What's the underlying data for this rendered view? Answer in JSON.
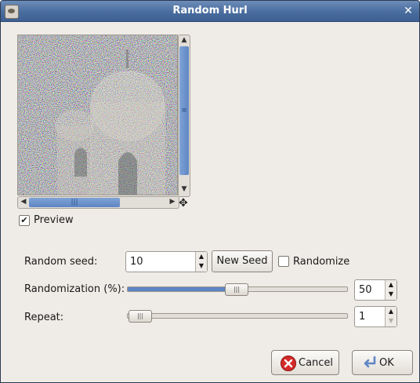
{
  "window": {
    "title": "Random Hurl"
  },
  "preview": {
    "checkbox_checked": true,
    "label": "Preview"
  },
  "random_seed": {
    "label": "Random seed:",
    "value": "10",
    "new_seed_label": "New Seed",
    "randomize_label": "Randomize",
    "randomize_checked": false
  },
  "randomization": {
    "label": "Randomization (%):",
    "value": "50",
    "slider_fraction": 0.5
  },
  "repeat": {
    "label": "Repeat:",
    "value": "1",
    "slider_fraction": 0.0
  },
  "buttons": {
    "cancel_label": "Cancel",
    "ok_label": "OK"
  },
  "icons": {
    "app": "gimp-icon",
    "close": "close-icon",
    "cancel": "cancel-icon",
    "ok": "ok-icon",
    "move": "move-icon"
  },
  "colors": {
    "titlebar": "#4a6d9f",
    "accent": "#5f86c4",
    "cancel_icon": "#d42a2a",
    "ok_icon": "#5f86c4"
  }
}
